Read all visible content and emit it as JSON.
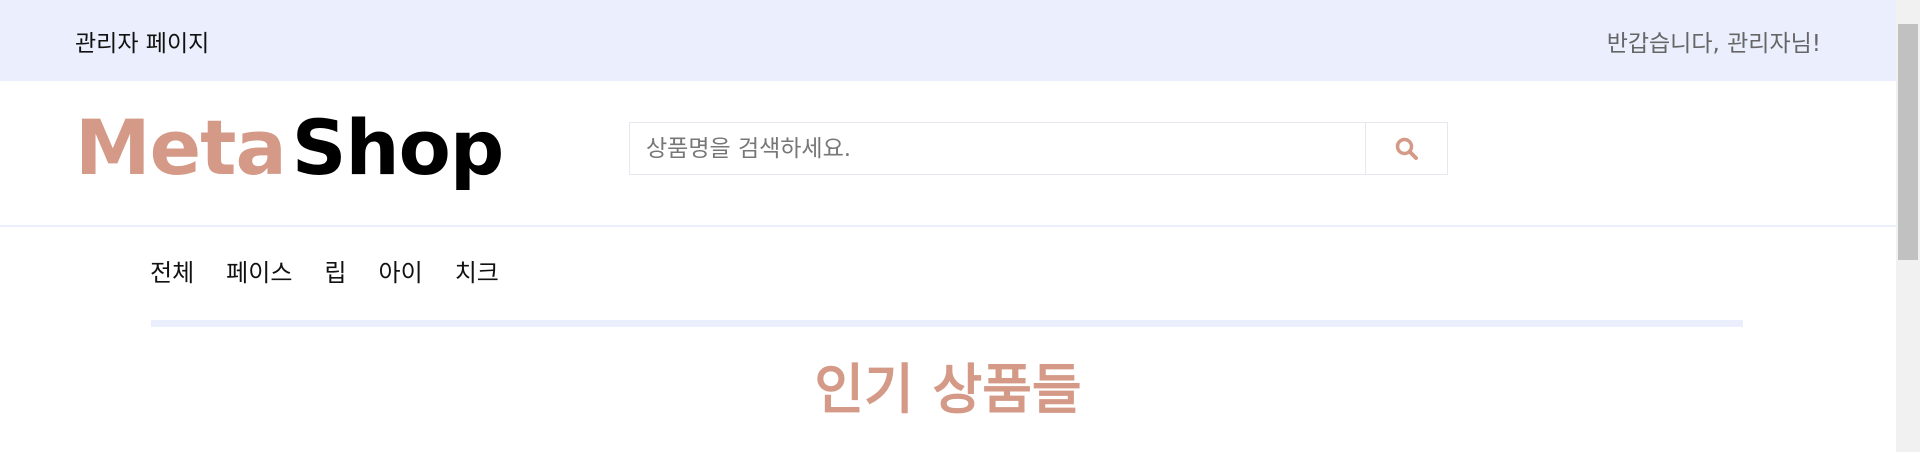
{
  "topbar": {
    "admin_link": "관리자 페이지",
    "greeting": "반갑습니다, 관리자님!"
  },
  "header": {
    "logo_meta": "Meta",
    "logo_shop": "Shop",
    "search_placeholder": "상품명을 검색하세요.",
    "search_icon": "search-icon"
  },
  "nav": {
    "items": [
      "전체",
      "페이스",
      "립",
      "아이",
      "치크"
    ]
  },
  "main": {
    "section_title": "인기 상품들"
  },
  "colors": {
    "accent": "#d49a87",
    "topbar_bg": "#ebeffd"
  }
}
